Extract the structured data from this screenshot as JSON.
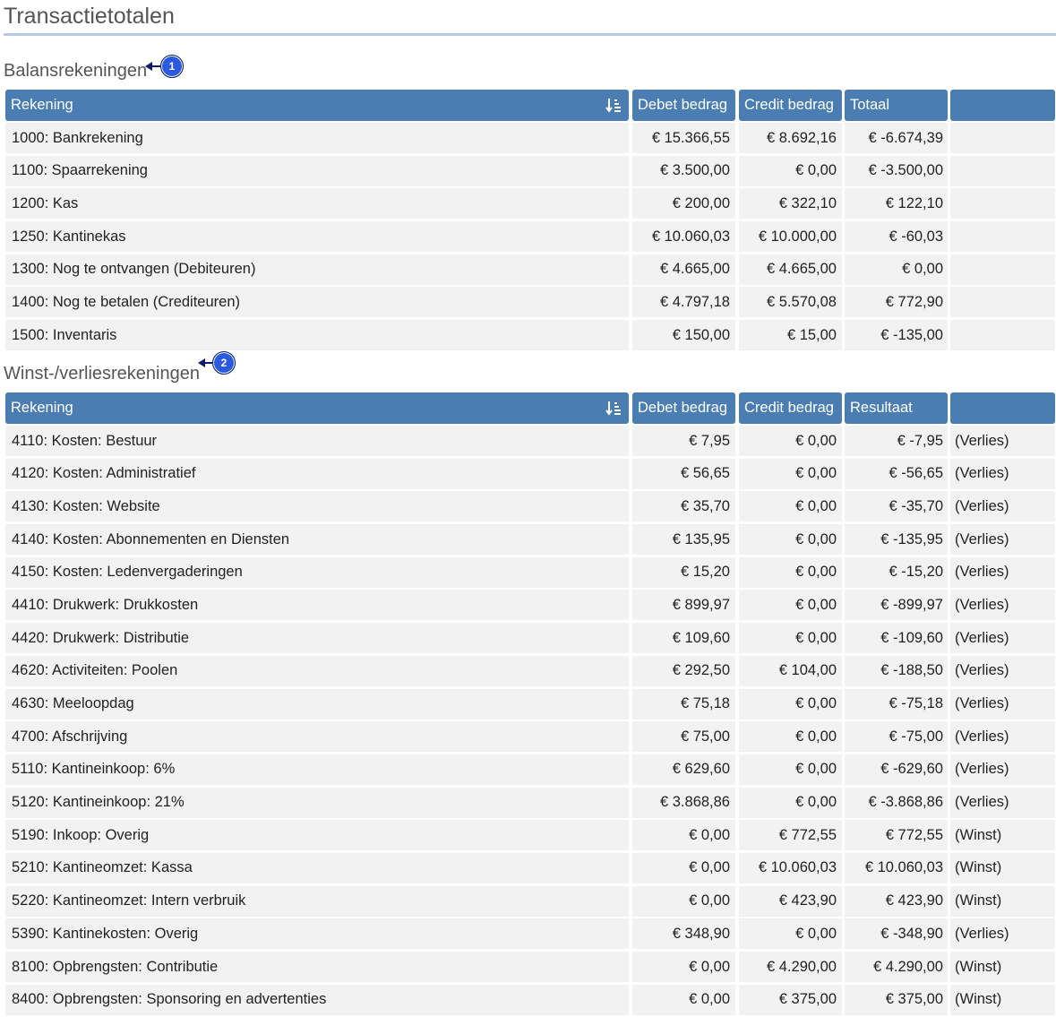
{
  "page": {
    "title": "Transactietotalen"
  },
  "balance": {
    "title": "Balansrekeningen",
    "callout": "1",
    "headers": [
      "Rekening",
      "Debet bedrag",
      "Credit bedrag",
      "Totaal",
      ""
    ],
    "rows": [
      [
        "1000: Bankrekening",
        "€ 15.366,55",
        "€ 8.692,16",
        "€ -6.674,39",
        ""
      ],
      [
        "1100: Spaarrekening",
        "€ 3.500,00",
        "€ 0,00",
        "€ -3.500,00",
        ""
      ],
      [
        "1200: Kas",
        "€ 200,00",
        "€ 322,10",
        "€ 122,10",
        ""
      ],
      [
        "1250: Kantinekas",
        "€ 10.060,03",
        "€ 10.000,00",
        "€ -60,03",
        ""
      ],
      [
        "1300: Nog te ontvangen (Debiteuren)",
        "€ 4.665,00",
        "€ 4.665,00",
        "€ 0,00",
        ""
      ],
      [
        "1400: Nog te betalen (Crediteuren)",
        "€ 4.797,18",
        "€ 5.570,08",
        "€ 772,90",
        ""
      ],
      [
        "1500: Inventaris",
        "€ 150,00",
        "€ 15,00",
        "€ -135,00",
        ""
      ]
    ]
  },
  "pnl": {
    "title": "Winst-/verliesrekeningen",
    "callout": "2",
    "headers": [
      "Rekening",
      "Debet bedrag",
      "Credit bedrag",
      "Resultaat",
      ""
    ],
    "rows": [
      [
        "4110: Kosten: Bestuur",
        "€ 7,95",
        "€ 0,00",
        "€ -7,95",
        "(Verlies)"
      ],
      [
        "4120: Kosten: Administratief",
        "€ 56,65",
        "€ 0,00",
        "€ -56,65",
        "(Verlies)"
      ],
      [
        "4130: Kosten: Website",
        "€ 35,70",
        "€ 0,00",
        "€ -35,70",
        "(Verlies)"
      ],
      [
        "4140: Kosten: Abonnementen en Diensten",
        "€ 135,95",
        "€ 0,00",
        "€ -135,95",
        "(Verlies)"
      ],
      [
        "4150: Kosten: Ledenvergaderingen",
        "€ 15,20",
        "€ 0,00",
        "€ -15,20",
        "(Verlies)"
      ],
      [
        "4410: Drukwerk: Drukkosten",
        "€ 899,97",
        "€ 0,00",
        "€ -899,97",
        "(Verlies)"
      ],
      [
        "4420: Drukwerk: Distributie",
        "€ 109,60",
        "€ 0,00",
        "€ -109,60",
        "(Verlies)"
      ],
      [
        "4620: Activiteiten: Poolen",
        "€ 292,50",
        "€ 104,00",
        "€ -188,50",
        "(Verlies)"
      ],
      [
        "4630: Meeloopdag",
        "€ 75,18",
        "€ 0,00",
        "€ -75,18",
        "(Verlies)"
      ],
      [
        "4700: Afschrijving",
        "€ 75,00",
        "€ 0,00",
        "€ -75,00",
        "(Verlies)"
      ],
      [
        "5110: Kantineinkoop: 6%",
        "€ 629,60",
        "€ 0,00",
        "€ -629,60",
        "(Verlies)"
      ],
      [
        "5120: Kantineinkoop: 21%",
        "€ 3.868,86",
        "€ 0,00",
        "€ -3.868,86",
        "(Verlies)"
      ],
      [
        "5190: Inkoop: Overig",
        "€ 0,00",
        "€ 772,55",
        "€ 772,55",
        "(Winst)"
      ],
      [
        "5210: Kantineomzet: Kassa",
        "€ 0,00",
        "€ 10.060,03",
        "€ 10.060,03",
        "(Winst)"
      ],
      [
        "5220: Kantineomzet: Intern verbruik",
        "€ 0,00",
        "€ 423,90",
        "€ 423,90",
        "(Winst)"
      ],
      [
        "5390: Kantinekosten: Overig",
        "€ 348,90",
        "€ 0,00",
        "€ -348,90",
        "(Verlies)"
      ],
      [
        "8100: Opbrengsten: Contributie",
        "€ 0,00",
        "€ 4.290,00",
        "€ 4.290,00",
        "(Winst)"
      ],
      [
        "8400: Opbrengsten: Sponsoring en advertenties",
        "€ 0,00",
        "€ 375,00",
        "€ 375,00",
        "(Winst)"
      ]
    ]
  },
  "icons": {
    "sort": "sort-descending-icon"
  },
  "colors": {
    "header_bg": "#4a7db1",
    "row_bg": "#f2f2f2",
    "callout": "#2b59e0",
    "rule": "#b6c8e4"
  }
}
